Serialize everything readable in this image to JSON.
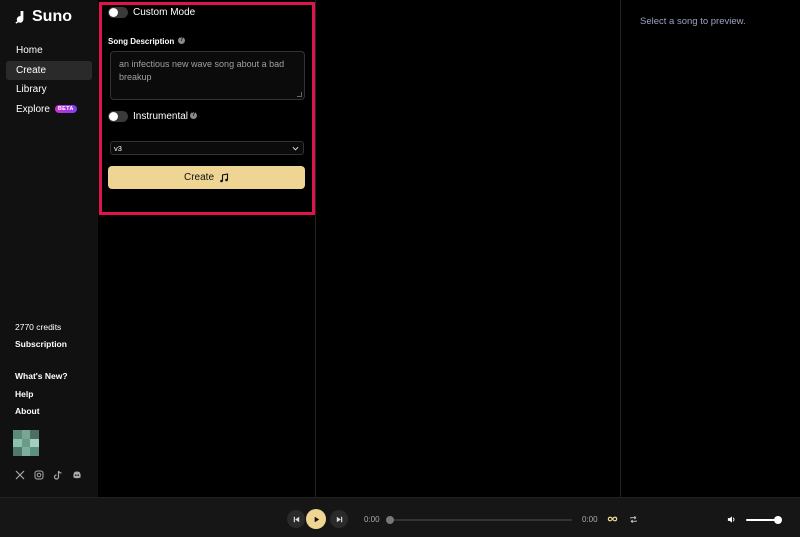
{
  "brand": {
    "name": "Suno"
  },
  "nav": {
    "items": [
      {
        "label": "Home"
      },
      {
        "label": "Create"
      },
      {
        "label": "Library"
      },
      {
        "label": "Explore",
        "badge": "BETA"
      }
    ]
  },
  "account": {
    "credits": "2770 credits",
    "subscription": "Subscription"
  },
  "footer_links": {
    "whats_new": "What's New?",
    "help": "Help",
    "about": "About"
  },
  "social_icons": [
    "x-icon",
    "instagram-icon",
    "tiktok-icon",
    "discord-icon"
  ],
  "create_form": {
    "custom_mode_label": "Custom Mode",
    "custom_mode_on": false,
    "song_description_label": "Song Description",
    "song_description_value": "an infectious new wave song about a bad breakup",
    "instrumental_label": "Instrumental",
    "instrumental_on": false,
    "model_version": "v3",
    "create_label": "Create"
  },
  "preview": {
    "empty_text": "Select a song to preview."
  },
  "player": {
    "current_time": "0:00",
    "duration": "0:00",
    "progress": 0,
    "volume": 1
  },
  "colors": {
    "accent": "#efd593",
    "highlight": "#e0144a",
    "beta_start": "#d02fd0",
    "beta_end": "#7b3ff0"
  }
}
